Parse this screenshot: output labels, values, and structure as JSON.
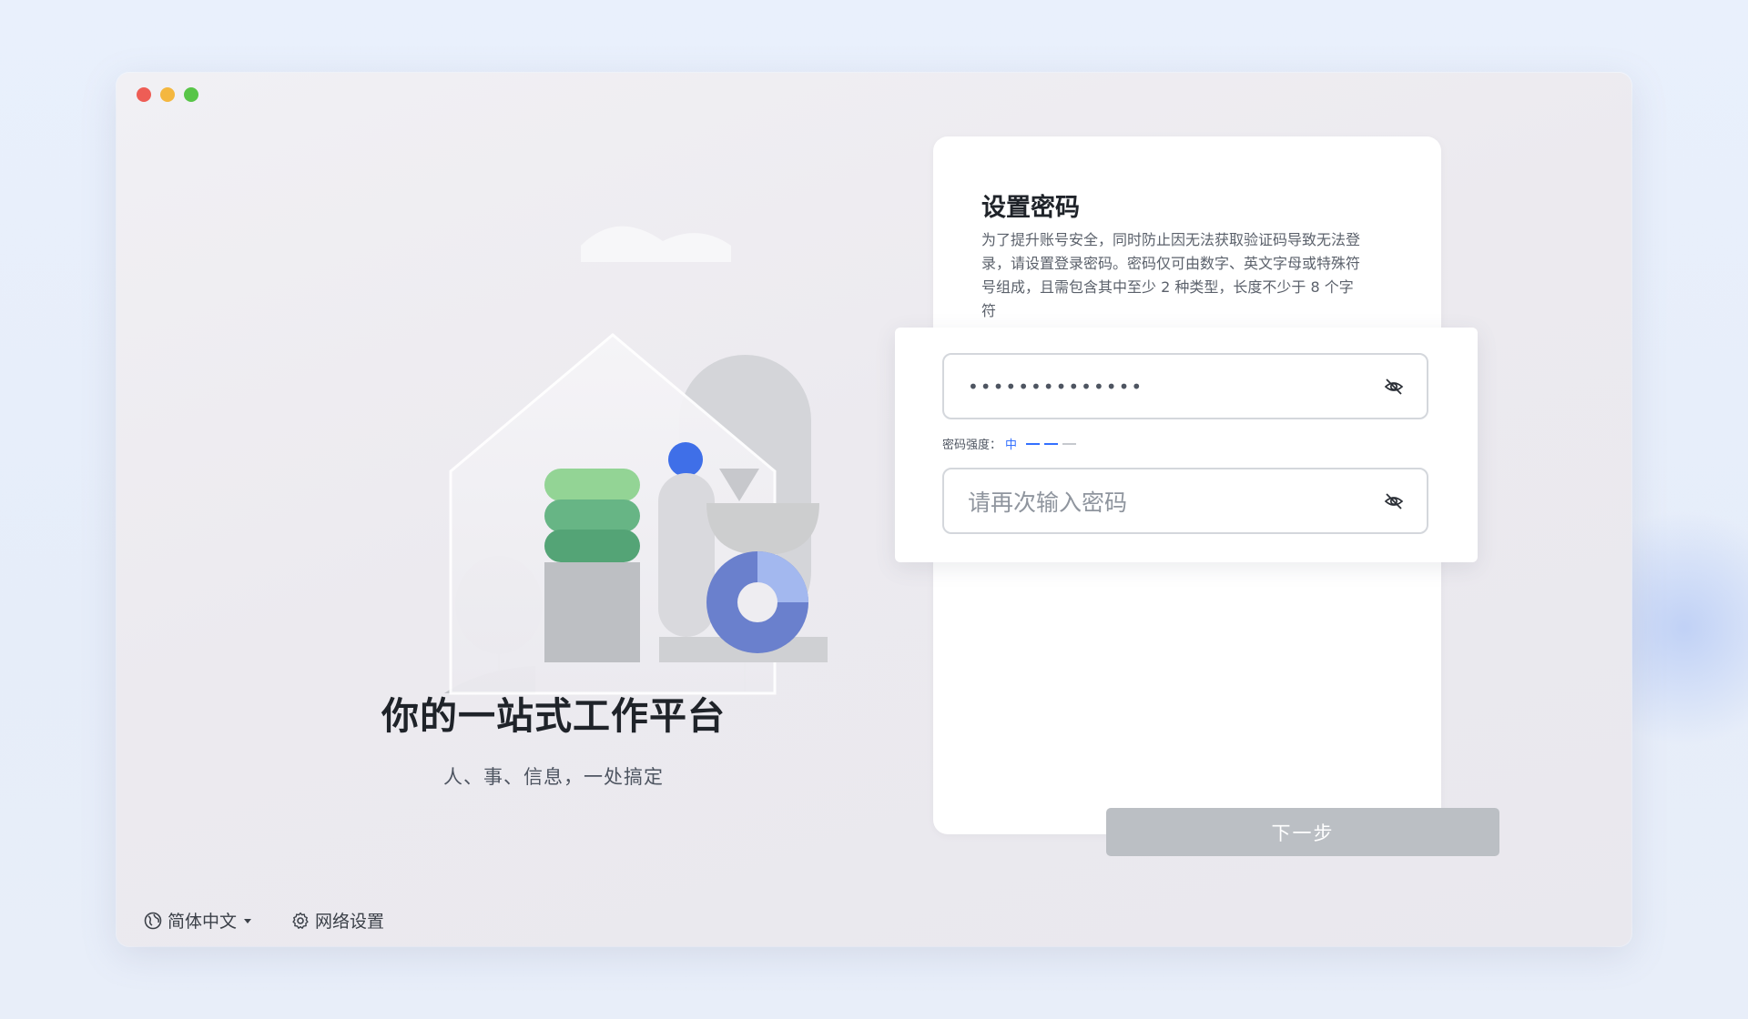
{
  "window": {
    "controls": [
      "close",
      "minimize",
      "maximize"
    ]
  },
  "hero": {
    "slogan": "你的一站式工作平台",
    "sub_slogan": "人、事、信息，一处搞定"
  },
  "footer": {
    "language_label": "简体中文",
    "network_label": "网络设置"
  },
  "form": {
    "title": "设置密码",
    "description": "为了提升账号安全，同时防止因无法获取验证码导致无法登录，请设置登录密码。密码仅可由数字、英文字母或特殊符号组成，且需包含其中至少 2 种类型，长度不少于 8 个字符",
    "password_value": "••••••••••••••",
    "strength_label": "密码强度：",
    "strength_level": "中",
    "strength_bars_filled": 2,
    "strength_bars_total": 3,
    "confirm_placeholder": "请再次输入密码",
    "next_label": "下一步"
  },
  "colors": {
    "accent": "#3370ff",
    "button_disabled": "#bbbfc4",
    "traffic_red": "#ee5d55",
    "traffic_yellow": "#f4b73f",
    "traffic_green": "#58c548"
  },
  "icons": [
    "globe-icon",
    "caret-down-icon",
    "gear-icon",
    "eye-off-icon"
  ]
}
